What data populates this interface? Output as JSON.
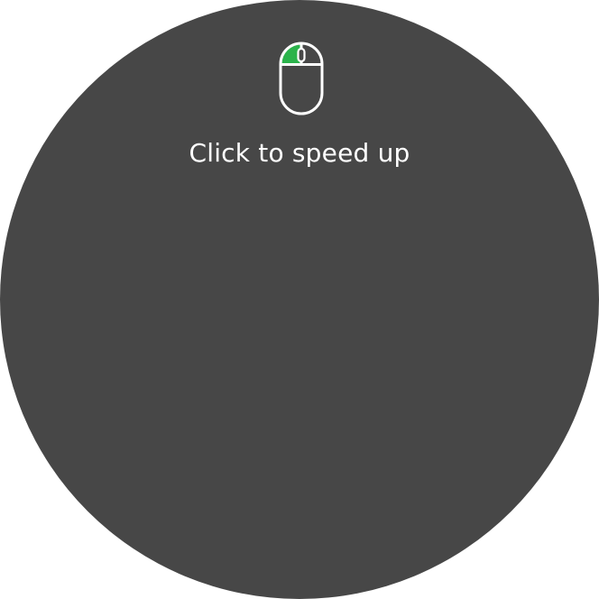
{
  "hint": {
    "text": "Click to speed up"
  },
  "icon": {
    "name": "mouse-left-click-icon",
    "highlight_button": "left"
  },
  "colors": {
    "background": "#ffffff",
    "dial": "#474747",
    "text": "#ffffff",
    "accent": "#2bb34b"
  }
}
